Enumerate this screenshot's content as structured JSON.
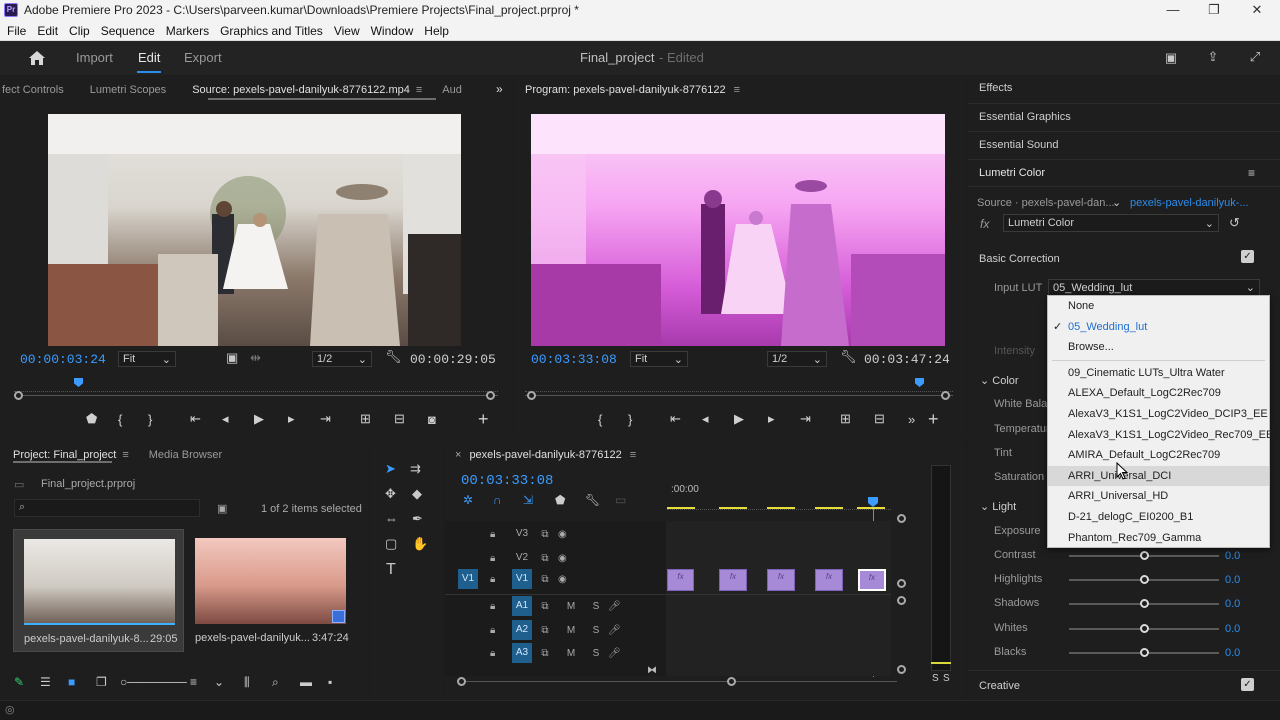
{
  "window": {
    "title": "Adobe Premiere Pro 2023 - C:\\Users\\parveen.kumar\\Downloads\\Premiere Projects\\Final_project.prproj *",
    "logo": "Pr",
    "minimize": "—",
    "maximize": "❐",
    "close": "✕"
  },
  "menu": [
    "File",
    "Edit",
    "Clip",
    "Sequence",
    "Markers",
    "Graphics and Titles",
    "View",
    "Window",
    "Help"
  ],
  "header": {
    "home_icon": "home-icon",
    "import": "Import",
    "edit": "Edit",
    "export": "Export",
    "project_name": "Final_project",
    "status": "- Edited"
  },
  "source": {
    "tabs": [
      "fect Controls",
      "Lumetri Scopes",
      "Source: pexels-pavel-danilyuk-8776122.mp4",
      "Aud"
    ],
    "timecode": "00:00:03:24",
    "fit": "Fit",
    "res": "1/2",
    "duration": "00:00:29:05",
    "more": "»"
  },
  "program": {
    "title": "Program: pexels-pavel-danilyuk-8776122",
    "timecode": "00:03:33:08",
    "fit": "Fit",
    "res": "1/2",
    "duration": "00:03:47:24"
  },
  "project": {
    "tabs": [
      "Project: Final_project",
      "Media Browser"
    ],
    "file": "Final_project.prproj",
    "selected": "1 of 2 items selected",
    "items": [
      {
        "name": "pexels-pavel-danilyuk-8...",
        "duration": "29:05"
      },
      {
        "name": "pexels-pavel-danilyuk...",
        "duration": "3:47:24"
      }
    ]
  },
  "timeline": {
    "title": "pexels-pavel-danilyuk-8776122",
    "timecode": "00:03:33:08",
    "ruler": ":00:00",
    "tracks": [
      "V3",
      "V2",
      "V1",
      "A1",
      "A2",
      "A3"
    ],
    "target": "V1",
    "track_m": "M",
    "track_s": "S",
    "clip_label": "fx",
    "meter_s": "S"
  },
  "right_panels": {
    "effects": "Effects",
    "essential_graphics": "Essential Graphics",
    "essential_sound": "Essential Sound",
    "lumetri": "Lumetri Color"
  },
  "lumetri": {
    "source": "Source · pexels-pavel-dan...",
    "clip": "pexels-pavel-danilyuk-...",
    "fx": "fx",
    "effect": "Lumetri Color",
    "basic": "Basic Correction",
    "input_lut_label": "Input LUT",
    "input_lut_value": "05_Wedding_lut",
    "intensity": "Intensity",
    "color": "Color",
    "white_balance": "White Balan",
    "temperature": "Temperatur",
    "tint": "Tint",
    "saturation": "Saturation",
    "light": "Light",
    "exposure": "Exposure",
    "sliders": [
      {
        "label": "Contrast",
        "value": "0.0"
      },
      {
        "label": "Highlights",
        "value": "0.0"
      },
      {
        "label": "Shadows",
        "value": "0.0"
      },
      {
        "label": "Whites",
        "value": "0.0"
      },
      {
        "label": "Blacks",
        "value": "0.0"
      }
    ],
    "creative": "Creative"
  },
  "lut_menu": {
    "items": [
      "None",
      "05_Wedding_lut",
      "Browse...",
      "09_Cinematic LUTs_Ultra Water",
      "ALEXA_Default_LogC2Rec709",
      "AlexaV3_K1S1_LogC2Video_DCIP3_EE",
      "AlexaV3_K1S1_LogC2Video_Rec709_EE",
      "AMIRA_Default_LogC2Rec709",
      "ARRI_Universal_DCI",
      "ARRI_Universal_HD",
      "D-21_delogC_EI0200_B1",
      "Phantom_Rec709_Gamma"
    ],
    "checked": 1,
    "highlighted": 8
  },
  "colors": {
    "accent": "#2d8ceb",
    "magenta_tint": "#e040e8",
    "clip": "#a68ad8"
  }
}
